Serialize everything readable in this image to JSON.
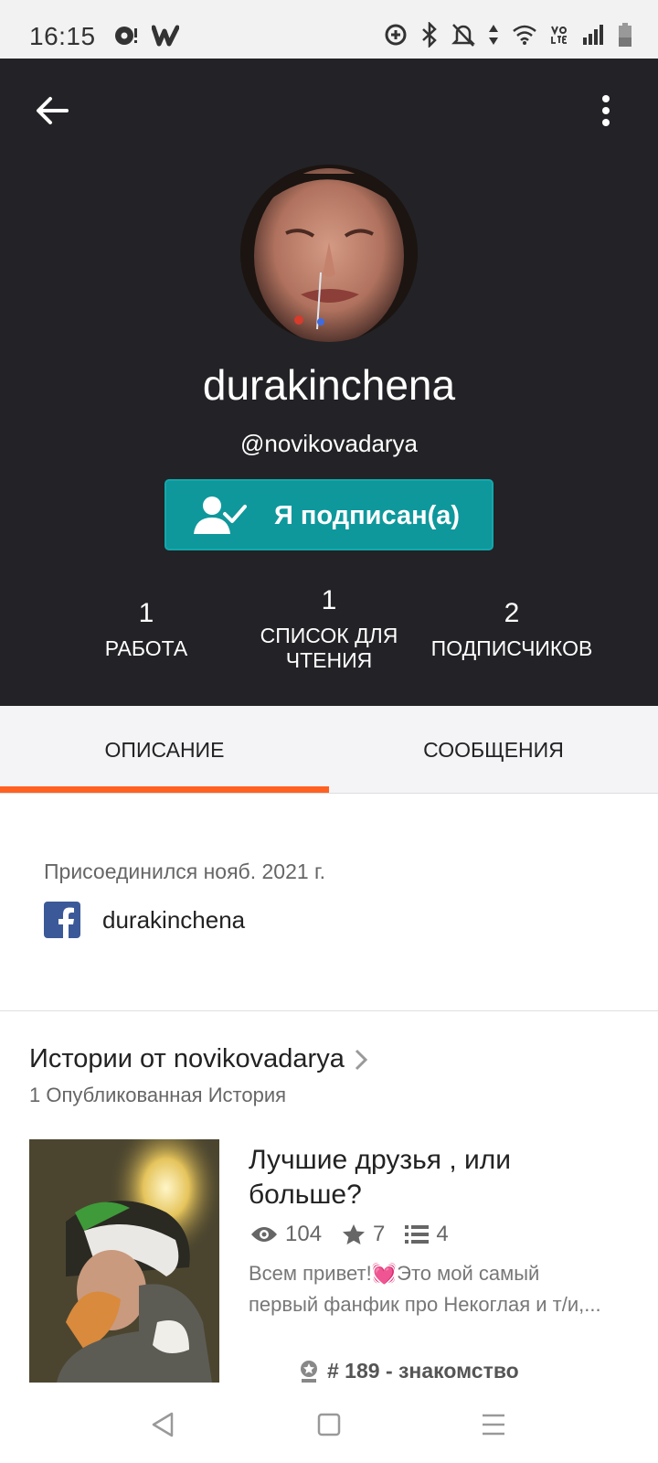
{
  "status_bar": {
    "time": "16:15"
  },
  "icons": {
    "back": "arrow-left-icon",
    "more": "more-vertical-icon",
    "follow": "user-check-icon",
    "facebook": "facebook-icon",
    "views": "eye-icon",
    "votes": "star-icon",
    "parts": "list-icon",
    "tag": "ranking-icon"
  },
  "profile": {
    "display_name": "durakinchena",
    "username": "@novikovadarya",
    "follow_label": "Я подписан(а)",
    "stats": {
      "works_count": "1",
      "works_label": "РАБОТА",
      "lists_count": "1",
      "lists_label_line1": "СПИСОК ДЛЯ",
      "lists_label_line2": "ЧТЕНИЯ",
      "followers_count": "2",
      "followers_label": "ПОДПИСЧИКОВ"
    }
  },
  "tabs": [
    {
      "label": "ОПИСАНИЕ",
      "active": true
    },
    {
      "label": "СООБЩЕНИЯ",
      "active": false
    }
  ],
  "about": {
    "joined": "Присоединился нояб. 2021 г.",
    "facebook_name": "durakinchena"
  },
  "stories": {
    "title": "Истории от novikovadarya",
    "count_label": "1 Опубликованная История",
    "items": [
      {
        "title": "Лучшие друзья , или больше?",
        "views": "104",
        "votes": "7",
        "parts": "4",
        "description_before": "Всем привет!",
        "description_emoji": "💓",
        "description_after": "Это мой самый первый фанфик про Некоглая и т/и,...",
        "tag": "# 189 - знакомство"
      }
    ]
  },
  "colors": {
    "header_bg": "#232226",
    "follow_button": "#0e989c",
    "tab_indicator": "#ff6122",
    "facebook": "#3b5998"
  }
}
